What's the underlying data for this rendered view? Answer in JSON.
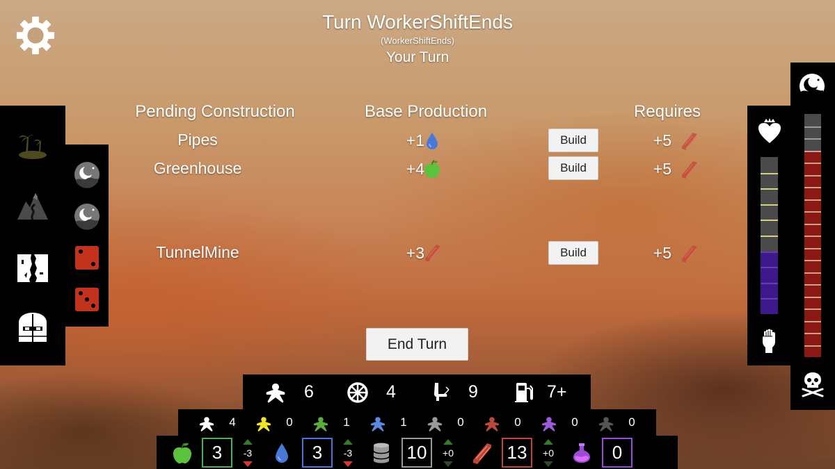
{
  "header": {
    "title": "Turn WorkerShiftEnds",
    "subtitle": "(WorkerShiftEnds)",
    "turn_status": "Your Turn"
  },
  "construction": {
    "headers": {
      "pending": "Pending Construction",
      "production": "Base Production",
      "requires": "Requires"
    },
    "rows": [
      {
        "name": "Pipes",
        "production": "+1",
        "production_icon": "water-drop-icon",
        "build_label": "Build",
        "requires": "+5",
        "requires_icon": "steel-beam-icon"
      },
      {
        "name": "Greenhouse",
        "production": "+4",
        "production_icon": "apple-icon",
        "build_label": "Build",
        "requires": "+5",
        "requires_icon": "steel-beam-icon"
      },
      {
        "name": "TunnelMine",
        "production": "+3",
        "production_icon": "steel-beam-icon",
        "build_label": "Build",
        "requires": "+5",
        "requires_icon": "steel-beam-icon"
      }
    ],
    "end_turn_label": "End Turn"
  },
  "left_sidebar": {
    "icons": [
      "island-icon",
      "mountain-road-icon",
      "tattered-flag-icon",
      "bunker-door-icon"
    ],
    "slots": [
      "night-moon-icon",
      "night-moon-icon",
      "die-one-icon",
      "die-two-icon"
    ]
  },
  "right_sidebar": {
    "top_icon": "night-moon-icon",
    "morale_icon": "crowned-heart-icon",
    "fist_icon": "raised-fist-icon",
    "skull_icon": "skull-crossbones-icon",
    "morale_gauge_cells": 10,
    "morale_gauge_filled": 4,
    "threat_gauge_cells": 20,
    "threat_gauge_filled": 17
  },
  "workers": {
    "top_row": [
      {
        "icon": "meeple-icon",
        "value": "6"
      },
      {
        "icon": "wheel-icon",
        "value": "4"
      },
      {
        "icon": "seat-icon",
        "value": "9"
      },
      {
        "icon": "fuel-pump-icon",
        "value": "7+"
      }
    ],
    "meeples": [
      {
        "color_name": "white",
        "color": "#ffffff",
        "value": "4"
      },
      {
        "color_name": "yellow",
        "color": "#f2e32a",
        "value": "0"
      },
      {
        "color_name": "green",
        "color": "#5aad3d",
        "value": "1"
      },
      {
        "color_name": "blue",
        "color": "#5a8ae0",
        "value": "1"
      },
      {
        "color_name": "gray",
        "color": "#9a9a9a",
        "value": "0"
      },
      {
        "color_name": "red",
        "color": "#b84a3c",
        "value": "0"
      },
      {
        "color_name": "purple",
        "color": "#9c5ad8",
        "value": "0"
      },
      {
        "color_name": "dark-gray",
        "color": "#555555",
        "value": "0"
      }
    ]
  },
  "resources": [
    {
      "name": "food",
      "icon": "apple-icon",
      "value": "3",
      "delta": "-3",
      "color": "#4caf50",
      "delta_negative": true
    },
    {
      "name": "water",
      "icon": "water-drop-icon",
      "value": "3",
      "delta": "-3",
      "color": "#4a78d6",
      "delta_negative": true
    },
    {
      "name": "fuel",
      "icon": "barrel-icon",
      "value": "10",
      "delta": "+0",
      "color": "#9a9a9a",
      "delta_negative": false
    },
    {
      "name": "steel",
      "icon": "steel-beam-icon",
      "value": "13",
      "delta": "+0",
      "color": "#c0463a",
      "delta_negative": false
    },
    {
      "name": "medicine",
      "icon": "potion-icon",
      "value": "0",
      "delta": "",
      "color": "#9c4ad8",
      "delta_negative": false
    }
  ],
  "colors": {
    "water": "#4a78d6",
    "food": "#4caf50",
    "steel": "#c0463a",
    "purple_gauge": "#3d1a8c",
    "red_gauge": "#8c1a14"
  }
}
